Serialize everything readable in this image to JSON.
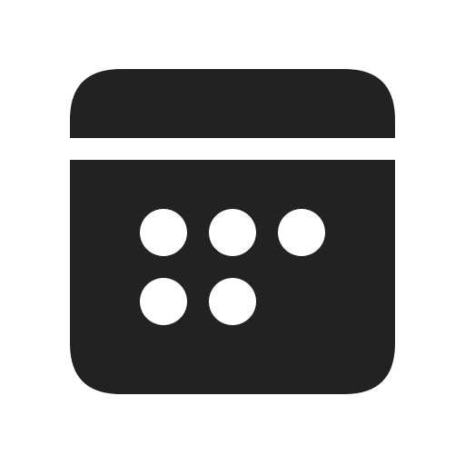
{
  "icon": {
    "name": "calendar-icon",
    "description_label": "",
    "colors": {
      "foreground": "#222222",
      "background": "#ffffff"
    },
    "day_dots_visible": 5
  }
}
